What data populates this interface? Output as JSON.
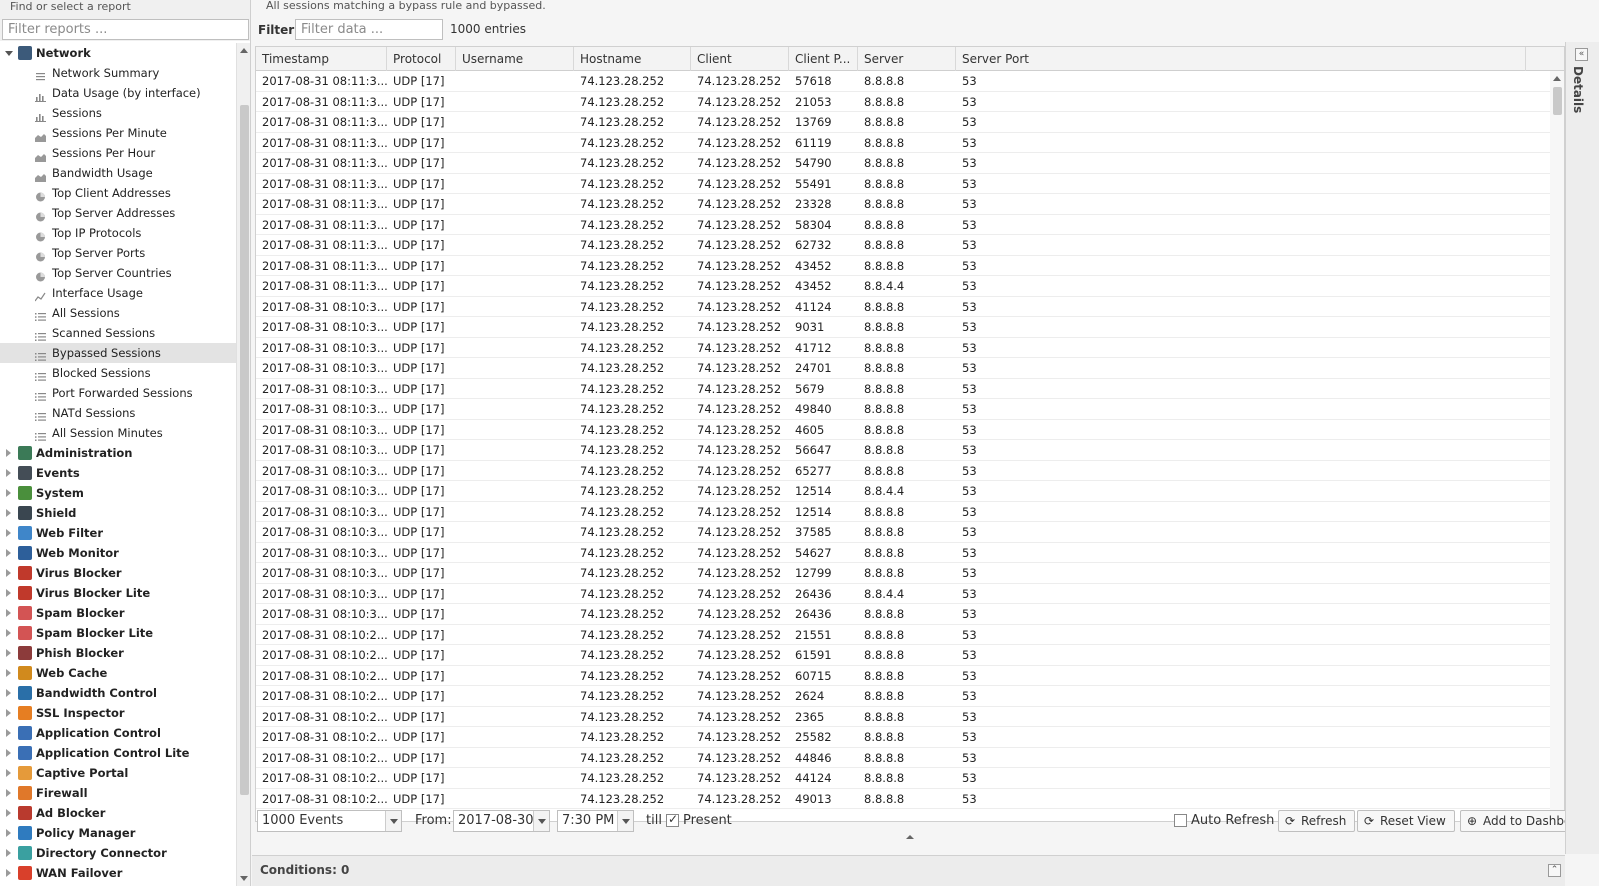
{
  "left": {
    "header": "Find or select a report",
    "filter_placeholder": "Filter reports ...",
    "tree": [
      {
        "label": "Network",
        "color": "#3c5a7a",
        "open": true,
        "children": [
          {
            "label": "Network Summary",
            "icon": "text-report-icon"
          },
          {
            "label": "Data Usage (by interface)",
            "icon": "bar-chart-icon"
          },
          {
            "label": "Sessions",
            "icon": "bar-chart-icon"
          },
          {
            "label": "Sessions Per Minute",
            "icon": "area-chart-icon"
          },
          {
            "label": "Sessions Per Hour",
            "icon": "area-chart-icon"
          },
          {
            "label": "Bandwidth Usage",
            "icon": "area-chart-icon"
          },
          {
            "label": "Top Client Addresses",
            "icon": "pie-chart-icon"
          },
          {
            "label": "Top Server Addresses",
            "icon": "pie-chart-icon"
          },
          {
            "label": "Top IP Protocols",
            "icon": "pie-chart-icon"
          },
          {
            "label": "Top Server Ports",
            "icon": "pie-chart-icon"
          },
          {
            "label": "Top Server Countries",
            "icon": "pie-chart-icon"
          },
          {
            "label": "Interface Usage",
            "icon": "line-chart-icon"
          },
          {
            "label": "All Sessions",
            "icon": "list-icon"
          },
          {
            "label": "Scanned Sessions",
            "icon": "list-icon"
          },
          {
            "label": "Bypassed Sessions",
            "icon": "list-icon",
            "selected": true
          },
          {
            "label": "Blocked Sessions",
            "icon": "list-icon"
          },
          {
            "label": "Port Forwarded Sessions",
            "icon": "list-icon"
          },
          {
            "label": "NATd Sessions",
            "icon": "list-icon"
          },
          {
            "label": "All Session Minutes",
            "icon": "list-icon"
          }
        ]
      },
      {
        "label": "Administration",
        "color": "#3b7a57"
      },
      {
        "label": "Events",
        "color": "#444d56"
      },
      {
        "label": "System",
        "color": "#4a8f3c"
      },
      {
        "label": "Shield",
        "color": "#3a4650"
      },
      {
        "label": "Web Filter",
        "color": "#3f86c9"
      },
      {
        "label": "Web Monitor",
        "color": "#2d5f9a"
      },
      {
        "label": "Virus Blocker",
        "color": "#c0392b"
      },
      {
        "label": "Virus Blocker Lite",
        "color": "#c0392b"
      },
      {
        "label": "Spam Blocker",
        "color": "#d35454"
      },
      {
        "label": "Spam Blocker Lite",
        "color": "#d35454"
      },
      {
        "label": "Phish Blocker",
        "color": "#8c3b3b"
      },
      {
        "label": "Web Cache",
        "color": "#d18a1d"
      },
      {
        "label": "Bandwidth Control",
        "color": "#2a6fa8"
      },
      {
        "label": "SSL Inspector",
        "color": "#e67e22"
      },
      {
        "label": "Application Control",
        "color": "#3a6fb5"
      },
      {
        "label": "Application Control Lite",
        "color": "#3a6fb5"
      },
      {
        "label": "Captive Portal",
        "color": "#e59a3a"
      },
      {
        "label": "Firewall",
        "color": "#e0782a"
      },
      {
        "label": "Ad Blocker",
        "color": "#b93a2e"
      },
      {
        "label": "Policy Manager",
        "color": "#2f7bbf"
      },
      {
        "label": "Directory Connector",
        "color": "#3aa0a0"
      },
      {
        "label": "WAN Failover",
        "color": "#d9402b"
      }
    ]
  },
  "main": {
    "description": "All sessions matching a bypass rule and bypassed.",
    "filter_label": "Filter:",
    "filter_placeholder": "Filter data ...",
    "entries": "1000 entries",
    "columns": [
      "Timestamp",
      "Protocol",
      "Username",
      "Hostname",
      "Client",
      "Client P...",
      "Server",
      "Server Port"
    ],
    "rows": [
      [
        "2017-08-31 08:11:3...",
        "UDP [17]",
        "",
        "74.123.28.252",
        "74.123.28.252",
        "57618",
        "8.8.8.8",
        "53"
      ],
      [
        "2017-08-31 08:11:3...",
        "UDP [17]",
        "",
        "74.123.28.252",
        "74.123.28.252",
        "21053",
        "8.8.8.8",
        "53"
      ],
      [
        "2017-08-31 08:11:3...",
        "UDP [17]",
        "",
        "74.123.28.252",
        "74.123.28.252",
        "13769",
        "8.8.8.8",
        "53"
      ],
      [
        "2017-08-31 08:11:3...",
        "UDP [17]",
        "",
        "74.123.28.252",
        "74.123.28.252",
        "61119",
        "8.8.8.8",
        "53"
      ],
      [
        "2017-08-31 08:11:3...",
        "UDP [17]",
        "",
        "74.123.28.252",
        "74.123.28.252",
        "54790",
        "8.8.8.8",
        "53"
      ],
      [
        "2017-08-31 08:11:3...",
        "UDP [17]",
        "",
        "74.123.28.252",
        "74.123.28.252",
        "55491",
        "8.8.8.8",
        "53"
      ],
      [
        "2017-08-31 08:11:3...",
        "UDP [17]",
        "",
        "74.123.28.252",
        "74.123.28.252",
        "23328",
        "8.8.8.8",
        "53"
      ],
      [
        "2017-08-31 08:11:3...",
        "UDP [17]",
        "",
        "74.123.28.252",
        "74.123.28.252",
        "58304",
        "8.8.8.8",
        "53"
      ],
      [
        "2017-08-31 08:11:3...",
        "UDP [17]",
        "",
        "74.123.28.252",
        "74.123.28.252",
        "62732",
        "8.8.8.8",
        "53"
      ],
      [
        "2017-08-31 08:11:3...",
        "UDP [17]",
        "",
        "74.123.28.252",
        "74.123.28.252",
        "43452",
        "8.8.8.8",
        "53"
      ],
      [
        "2017-08-31 08:11:3...",
        "UDP [17]",
        "",
        "74.123.28.252",
        "74.123.28.252",
        "43452",
        "8.8.4.4",
        "53"
      ],
      [
        "2017-08-31 08:10:3...",
        "UDP [17]",
        "",
        "74.123.28.252",
        "74.123.28.252",
        "41124",
        "8.8.8.8",
        "53"
      ],
      [
        "2017-08-31 08:10:3...",
        "UDP [17]",
        "",
        "74.123.28.252",
        "74.123.28.252",
        "9031",
        "8.8.8.8",
        "53"
      ],
      [
        "2017-08-31 08:10:3...",
        "UDP [17]",
        "",
        "74.123.28.252",
        "74.123.28.252",
        "41712",
        "8.8.8.8",
        "53"
      ],
      [
        "2017-08-31 08:10:3...",
        "UDP [17]",
        "",
        "74.123.28.252",
        "74.123.28.252",
        "24701",
        "8.8.8.8",
        "53"
      ],
      [
        "2017-08-31 08:10:3...",
        "UDP [17]",
        "",
        "74.123.28.252",
        "74.123.28.252",
        "5679",
        "8.8.8.8",
        "53"
      ],
      [
        "2017-08-31 08:10:3...",
        "UDP [17]",
        "",
        "74.123.28.252",
        "74.123.28.252",
        "49840",
        "8.8.8.8",
        "53"
      ],
      [
        "2017-08-31 08:10:3...",
        "UDP [17]",
        "",
        "74.123.28.252",
        "74.123.28.252",
        "4605",
        "8.8.8.8",
        "53"
      ],
      [
        "2017-08-31 08:10:3...",
        "UDP [17]",
        "",
        "74.123.28.252",
        "74.123.28.252",
        "56647",
        "8.8.8.8",
        "53"
      ],
      [
        "2017-08-31 08:10:3...",
        "UDP [17]",
        "",
        "74.123.28.252",
        "74.123.28.252",
        "65277",
        "8.8.8.8",
        "53"
      ],
      [
        "2017-08-31 08:10:3...",
        "UDP [17]",
        "",
        "74.123.28.252",
        "74.123.28.252",
        "12514",
        "8.8.4.4",
        "53"
      ],
      [
        "2017-08-31 08:10:3...",
        "UDP [17]",
        "",
        "74.123.28.252",
        "74.123.28.252",
        "12514",
        "8.8.8.8",
        "53"
      ],
      [
        "2017-08-31 08:10:3...",
        "UDP [17]",
        "",
        "74.123.28.252",
        "74.123.28.252",
        "37585",
        "8.8.8.8",
        "53"
      ],
      [
        "2017-08-31 08:10:3...",
        "UDP [17]",
        "",
        "74.123.28.252",
        "74.123.28.252",
        "54627",
        "8.8.8.8",
        "53"
      ],
      [
        "2017-08-31 08:10:3...",
        "UDP [17]",
        "",
        "74.123.28.252",
        "74.123.28.252",
        "12799",
        "8.8.8.8",
        "53"
      ],
      [
        "2017-08-31 08:10:3...",
        "UDP [17]",
        "",
        "74.123.28.252",
        "74.123.28.252",
        "26436",
        "8.8.4.4",
        "53"
      ],
      [
        "2017-08-31 08:10:3...",
        "UDP [17]",
        "",
        "74.123.28.252",
        "74.123.28.252",
        "26436",
        "8.8.8.8",
        "53"
      ],
      [
        "2017-08-31 08:10:2...",
        "UDP [17]",
        "",
        "74.123.28.252",
        "74.123.28.252",
        "21551",
        "8.8.8.8",
        "53"
      ],
      [
        "2017-08-31 08:10:2...",
        "UDP [17]",
        "",
        "74.123.28.252",
        "74.123.28.252",
        "61591",
        "8.8.8.8",
        "53"
      ],
      [
        "2017-08-31 08:10:2...",
        "UDP [17]",
        "",
        "74.123.28.252",
        "74.123.28.252",
        "60715",
        "8.8.8.8",
        "53"
      ],
      [
        "2017-08-31 08:10:2...",
        "UDP [17]",
        "",
        "74.123.28.252",
        "74.123.28.252",
        "2624",
        "8.8.8.8",
        "53"
      ],
      [
        "2017-08-31 08:10:2...",
        "UDP [17]",
        "",
        "74.123.28.252",
        "74.123.28.252",
        "2365",
        "8.8.8.8",
        "53"
      ],
      [
        "2017-08-31 08:10:2...",
        "UDP [17]",
        "",
        "74.123.28.252",
        "74.123.28.252",
        "25582",
        "8.8.8.8",
        "53"
      ],
      [
        "2017-08-31 08:10:2...",
        "UDP [17]",
        "",
        "74.123.28.252",
        "74.123.28.252",
        "44846",
        "8.8.8.8",
        "53"
      ],
      [
        "2017-08-31 08:10:2...",
        "UDP [17]",
        "",
        "74.123.28.252",
        "74.123.28.252",
        "44124",
        "8.8.8.8",
        "53"
      ],
      [
        "2017-08-31 08:10:2...",
        "UDP [17]",
        "",
        "74.123.28.252",
        "74.123.28.252",
        "49013",
        "8.8.8.8",
        "53"
      ]
    ]
  },
  "toolbar": {
    "events_select": "1000 Events",
    "from_label": "From:",
    "from_date": "2017-08-30",
    "from_time": "7:30 PM",
    "till_label": "till",
    "present_label": "Present",
    "present_checked": true,
    "auto_refresh_label": "Auto Refresh",
    "auto_refresh_checked": false,
    "refresh_label": "Refresh",
    "reset_view_label": "Reset View",
    "add_dashboard_label": "Add to Dashboard"
  },
  "conditions": {
    "label": "Conditions: 0"
  },
  "details": {
    "title": "Details"
  }
}
